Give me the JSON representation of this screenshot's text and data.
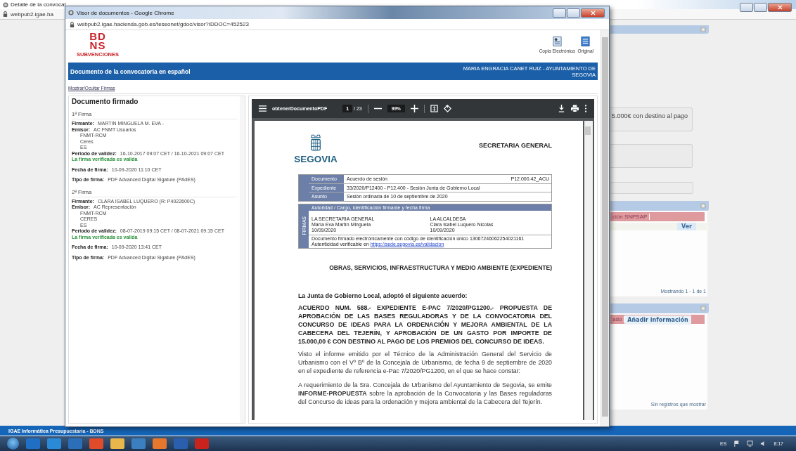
{
  "background_window": {
    "tab_title": "Detalle de la convocat",
    "address": "webpub2.igae.ha",
    "form": {
      "description_value": "5.000€ con destino al pago"
    },
    "documents_panel": {
      "columns": [
        "ción SNPSAP"
      ],
      "action": "Ver",
      "pager": "Mostrando 1 - 1 de 1"
    },
    "info_panel": {
      "columns": [
        "ado"
      ],
      "add_button": "Añadir información",
      "empty_message": "Sin registros que mostrar"
    },
    "footer": "IGAE Informática Presupuestaria - BDNS"
  },
  "viewer_window": {
    "title": "Visor de documentos - Google Chrome",
    "address": "webpub2.igae.hacienda.gob.es/teseonet/gdoc/visor?IDDOC=452523",
    "logo": {
      "lines": [
        "BD",
        "NS"
      ],
      "tagline": "SUBVENCIONES"
    },
    "downloads": [
      {
        "kind": "copy",
        "label": "Copia Electrónica"
      },
      {
        "kind": "original",
        "label": "Original"
      }
    ],
    "banner": {
      "title": "Documento de la convocatoria en español",
      "owner": "MARIA ENGRACIA CANET RUIZ - AYUNTAMIENTO DE SEGOVIA"
    },
    "toggle_link": "Mostrar/Ocultar Firmas",
    "signatures_panel": {
      "title": "Documento firmado",
      "signatures": [
        {
          "heading": "1ª Firma",
          "signer": {
            "label": "Firmante:",
            "value": "MARTIN MINGUELA M. EVA -"
          },
          "issuer": {
            "label": "Emisor:",
            "lines": [
              "AC FNMT Usuarios",
              "FNMT-RCM",
              "Ceres",
              "ES"
            ]
          },
          "validity": {
            "label": "Periodo de validez:",
            "value": "16-10-2017 09:07 CET / 16-10-2021 09:07 CET"
          },
          "status": "La firma verificada es valida",
          "verified": true,
          "date": {
            "label": "Fecha de firma:",
            "value": "10-09-2020 11:10 CET"
          },
          "type": {
            "label": "Tipo de firma:",
            "value": "PDF Advanced Digital Sigature (PAdES)"
          }
        },
        {
          "heading": "2ª Firma",
          "signer": {
            "label": "Firmante:",
            "value": "CLARA ISABEL LUQUERO (R: P4022600C)"
          },
          "issuer": {
            "label": "Emisor:",
            "lines": [
              "AC Representación",
              "FNMT-RCM",
              "CERES",
              "ES"
            ]
          },
          "validity": {
            "label": "Periodo de validez:",
            "value": "08-07-2019 09:15 CET / 08-07-2021 09:15 CET"
          },
          "status": "La firma verificada es valida",
          "verified": true,
          "date": {
            "label": "Fecha de firma:",
            "value": "10-09-2020 13:41 CET"
          },
          "type": {
            "label": "Tipo de firma:",
            "value": "PDF Advanced Digital Sigature (PAdES)"
          }
        }
      ]
    },
    "pdf": {
      "file_name": "obtenerDocumentoPDF",
      "page": "1",
      "page_count": "/ 23",
      "zoom": "99%",
      "page_content": {
        "city": "SEGOVIA",
        "department": "SECRETARIA GENERAL",
        "info_rows": [
          {
            "label": "Documento",
            "value": "Acuerdo de sesión",
            "code": "P12.000.42_ACU"
          },
          {
            "label": "Expediente",
            "value": "33/2020/P12400 - P12.400 - Sesión Junta de Gobierno Local"
          },
          {
            "label": "Asunto",
            "value": "Sesión ordinaria de 10 de septiembre de 2020"
          }
        ],
        "signatures_table": {
          "side_label": "FIRMAS",
          "header": "Autoridad / Cargo, identificación firmante y fecha firma",
          "signers": [
            {
              "lines": [
                "LA SECRETARIA GENERAL",
                "María Eva Martín Minguela",
                "10/09/2020"
              ]
            },
            {
              "lines": [
                "LA ALCALDESA",
                "Clara Isabel Luquero Nicolas",
                "10/09/2020"
              ]
            }
          ],
          "code_note": "Documento firmado electrónicamente con código de identificación único  13067246062254021161",
          "verify_note": "Autenticidad verificable en",
          "verify_link": "https://sede.segovia.es/validacion"
        },
        "section_heading": "OBRAS, SERVICIOS, INFRAESTRUCTURA Y MEDIO AMBIENTE  (EXPEDIENTE)",
        "intro": "La Junta de Gobierno Local, adoptó el siguiente acuerdo:",
        "agreement": "ACUERDO NUM. 588.- EXPEDIENTE E-PAC 7/2020/PG1200.- PROPUESTA DE APROBACIÓN DE LAS BASES REGULADORAS Y DE LA CONVOCATORIA DEL CONCURSO DE IDEAS PARA LA ORDENACIÓN Y MEJORA AMBIENTAL DE LA CABECERA DEL TEJERÍN, Y APROBACIÓN DE UN GASTO POR IMPORTE DE 15.000,00 € CON DESTINO AL PAGO DE LOS PREMIOS DEL CONCURSO DE IDEAS.",
        "paragraphs": [
          "Visto el informe emitido por el Técnico de la Administración General del Servicio de Urbanismo con el Vº Bº de la Concejala de Urbanismo, de fecha 9 de septiembre de 2020 en el expediente de referencia e-Pac 7/2020/PG1200, en el que se hace constar:",
          "A requerimiento de la Sra. Concejala de Urbanismo del Ayuntamiento de Segovia, se emite **INFORME-PROPUESTA** sobre la aprobación de la Convocatoria y las Bases reguladoras del Concurso de ideas para la ordenación y mejora ambiental de la Cabecera del Tejerín."
        ]
      }
    }
  },
  "taskbar": {
    "language": "ES",
    "time": "8:17"
  }
}
